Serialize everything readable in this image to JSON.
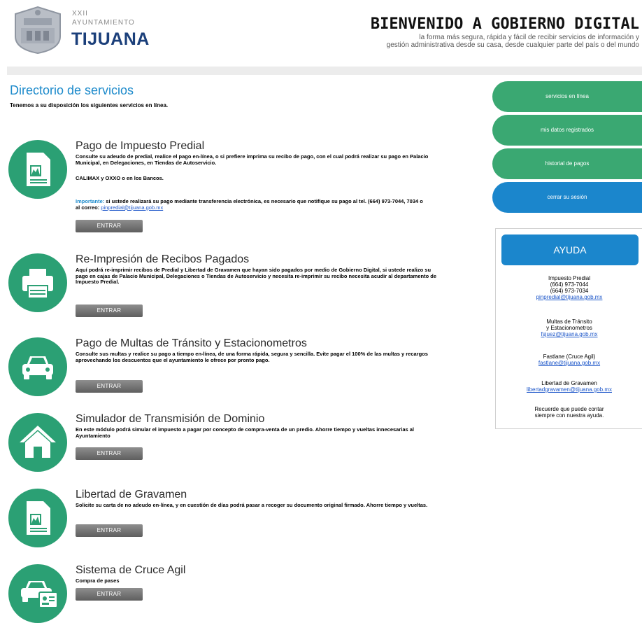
{
  "header": {
    "logo_top": "XXII",
    "logo_mid": "AYUNTAMIENTO",
    "logo_city": "TIJUANA",
    "welcome": "BIENVENIDO A GOBIERNO DIGITAL",
    "subtitle_line1": "la forma más segura, rápida y fácil de recibir servicios de información y",
    "subtitle_line2": "gestión administrativa desde su casa, desde cualquier parte del país o del mundo"
  },
  "directory": {
    "title": "Directorio de servicios",
    "intro": "Tenemos a su disposición los siguientes servicios en línea."
  },
  "button_label": "ENTRAR",
  "services": [
    {
      "title": "Pago de Impuesto Predial",
      "desc": "Consulte su adeudo de predial, realice el pago en-línea, o si prefiere imprima su recibo de pago, con el cual podrá realizar su pago en Palacio Municipal, en Delegaciones, en Tiendas de Autoservicio.",
      "desc2": "CALIMAX y OXXO o en los Bancos.",
      "important_label": "Importante:",
      "important_text": "si ustede realizará su pago mediante transferencia electrónica, es necesario que notifique su pago al tel. (664) 973-7044, 7034 o al correo:",
      "important_email": "pinpredial@tijuana.gob.mx",
      "icon": "document-icon"
    },
    {
      "title": "Re-Impresión de Recibos Pagados",
      "desc": "Aquí podrá re-imprimir recibos de Predial y Libertad de Gravamen que hayan sido pagados por medio de Gobierno Digital, si ustede realizo su pago en cajas de Palacio Municipal, Delegaciones o Tiendas de Autoservicio y necesita re-imprimir su recibo necesita acudir al departamento de Impuesto Predial.",
      "icon": "printer-icon"
    },
    {
      "title": "Pago de Multas de Tránsito y Estacionometros",
      "desc": "Consulte sus multas y realice su pago a tiempo en-línea, de una forma rápida, segura y sencilla. Evite pagar el 100% de las multas y recargos aprovechando los descuentos que el ayuntamiento le ofrece por pronto pago.",
      "icon": "car-icon"
    },
    {
      "title": "Simulador de Transmisión de Dominio",
      "desc": "En este módulo podrá simular el impuesto a pagar por concepto de compra-venta de un predio. Ahorre tiempo y vueltas innecesarias al Ayuntamiento",
      "icon": "house-icon"
    },
    {
      "title": "Libertad de Gravamen",
      "desc": "Solicite su carta de no adeudo en-línea, y en cuestión de días podrá pasar a recoger su documento original firmado. Ahorre tiempo y vueltas.",
      "icon": "document-icon"
    },
    {
      "title": "Sistema de Cruce Agil",
      "desc": "Compra de pases",
      "icon": "car-id-icon"
    }
  ],
  "sidebar": {
    "buttons": [
      "servicios en línea",
      "mis datos registrados",
      "historial de pagos",
      "cerrar su sesión"
    ],
    "help_title": "AYUDA",
    "help": [
      {
        "lines": [
          "Impuesto Predial",
          "(664) 973-7044",
          "(664) 973-7034"
        ],
        "email": "pinpredial@tijuana.gob.mx"
      },
      {
        "lines": [
          "Multas de Tránsito",
          "y Estacionometros"
        ],
        "email": "fsjuez@tijuana.gob.mx"
      },
      {
        "lines": [
          "Fastlane (Cruce Agil)"
        ],
        "email": "fastlane@tijuana.gob.mx"
      },
      {
        "lines": [
          "Libertad de Gravamen"
        ],
        "email": "libertadgravamen@tijuana.gob.mx"
      },
      {
        "lines": [
          "Recuerde que puede contar",
          "siempre con nuestra ayuda."
        ],
        "email": ""
      }
    ]
  },
  "colors": {
    "accent_green": "#3aa872",
    "accent_blue": "#1b86cc",
    "title_blue": "#1c8acb"
  }
}
